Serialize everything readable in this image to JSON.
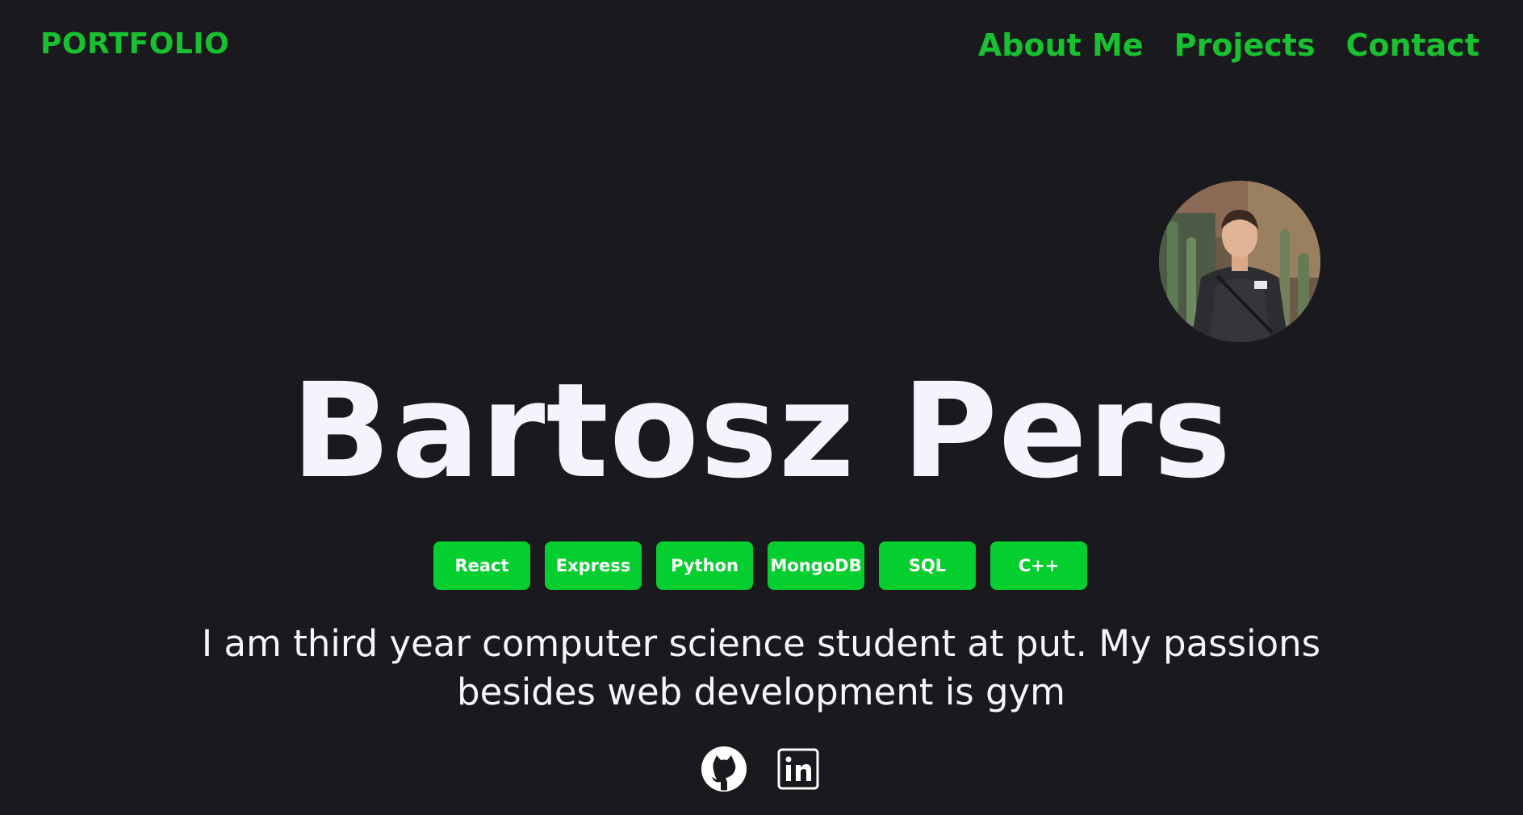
{
  "navbar": {
    "logo": "PORTFOLIO",
    "links": [
      {
        "label": "About Me"
      },
      {
        "label": "Projects"
      },
      {
        "label": "Contact"
      }
    ]
  },
  "hero": {
    "name": "Bartosz Pers",
    "skills": [
      "React",
      "Express",
      "Python",
      "MongoDB",
      "SQL",
      "C++"
    ],
    "bio": "I am third year computer science student at put. My passions besides web development is gym"
  },
  "socials": [
    {
      "icon": "github-icon"
    },
    {
      "icon": "linkedin-icon"
    }
  ],
  "colors": {
    "background": "#1a1a1e",
    "accent": "#17c12f",
    "tag_background": "#05cf2e",
    "text": "#f5f5fa"
  }
}
